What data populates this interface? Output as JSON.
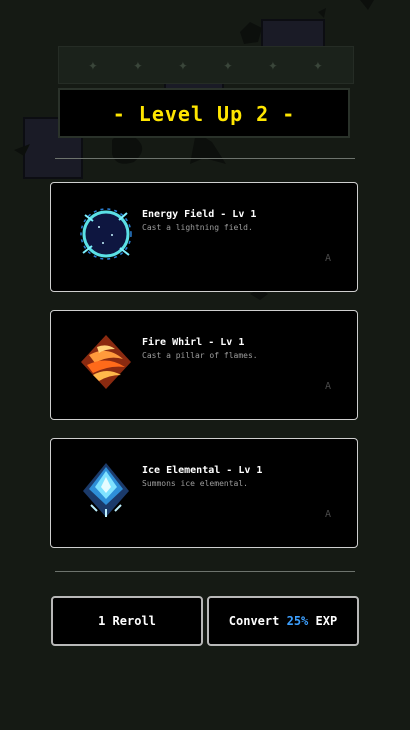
{
  "header": {
    "title": "- Level Up 2 -"
  },
  "choices": [
    {
      "name": "Energy Field - Lv 1",
      "description": "Cast a lightning field.",
      "hotkey": "A",
      "icon": "energy-field-icon"
    },
    {
      "name": "Fire Whirl - Lv 1",
      "description": "Cast a pillar of flames.",
      "hotkey": "A",
      "icon": "fire-whirl-icon"
    },
    {
      "name": "Ice Elemental - Lv 1",
      "description": "Summons ice elemental.",
      "hotkey": "A",
      "icon": "ice-elemental-icon"
    }
  ],
  "actions": {
    "reroll_label": "1 Reroll",
    "convert_prefix": "Convert",
    "convert_percent": "25%",
    "convert_suffix": "EXP"
  },
  "colors": {
    "title": "#ffe600",
    "accent": "#3da0ff",
    "card_border": "#cfcfcf",
    "background": "#151a14"
  }
}
